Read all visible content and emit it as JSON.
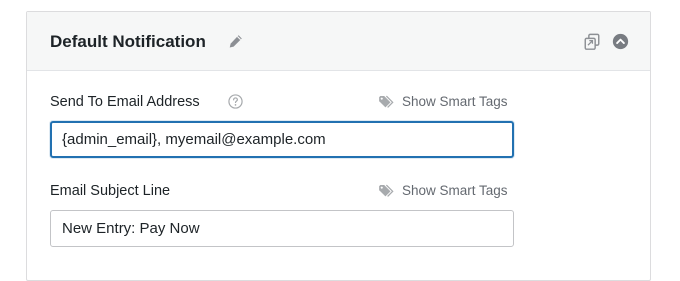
{
  "panel": {
    "title": "Default Notification"
  },
  "fields": {
    "send_to": {
      "label": "Send To Email Address",
      "smart_tags_label": "Show Smart Tags",
      "value": "{admin_email}, myemail@example.com"
    },
    "subject": {
      "label": "Email Subject Line",
      "smart_tags_label": "Show Smart Tags",
      "value": "New Entry: Pay Now"
    }
  },
  "colors": {
    "accent": "#2271b1",
    "header_bg": "#f6f7f7",
    "border": "#dcdcde",
    "muted_icon": "#a7aaad"
  },
  "icons": [
    "pencil-icon",
    "clone-icon",
    "chevron-up-circle-icon",
    "help-icon",
    "tag-icon"
  ]
}
